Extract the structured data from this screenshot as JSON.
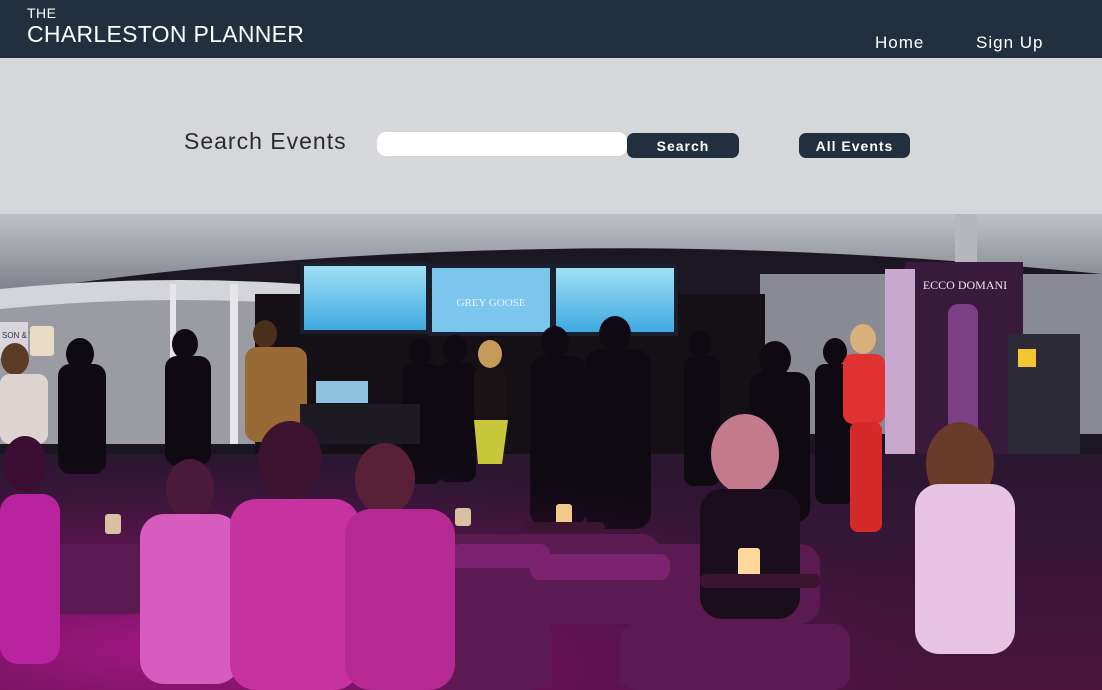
{
  "header": {
    "logo_small": "THE",
    "logo_big": "CHARLESTON PLANNER",
    "nav": [
      {
        "label": "Home"
      },
      {
        "label": "Sign Up"
      }
    ],
    "background": "#212f3e"
  },
  "search": {
    "label": "Search Events",
    "input_value": "",
    "search_button": "Search",
    "all_events_button": "All Events",
    "background": "#d5d7da"
  },
  "hero": {
    "screen_text": "GREY GOOSE",
    "banner_text": "ECCO DOMANI",
    "sign_text": "SON & TIES"
  }
}
